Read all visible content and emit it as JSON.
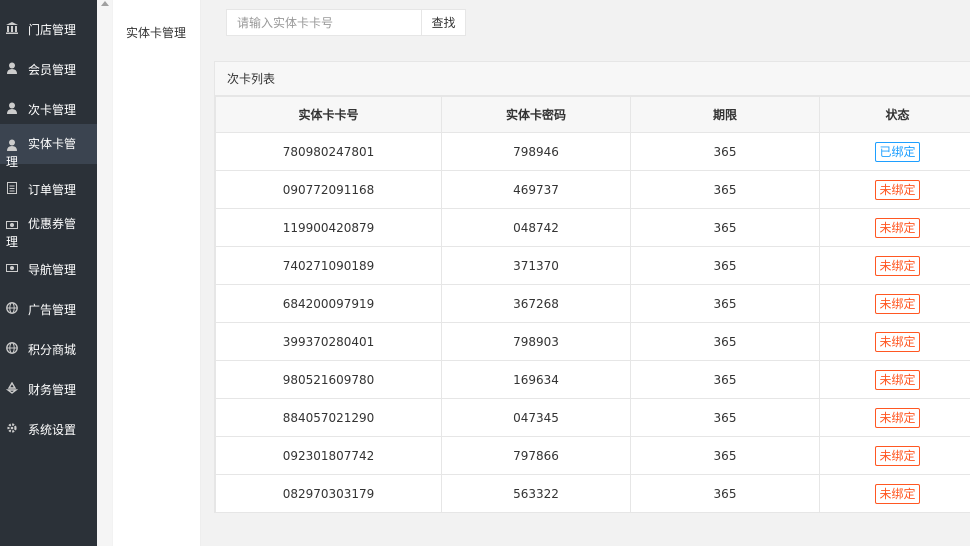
{
  "sidebar": {
    "items": [
      {
        "label": "门店管理",
        "icon": "bank-icon"
      },
      {
        "label": "会员管理",
        "icon": "user-icon"
      },
      {
        "label": "次卡管理",
        "icon": "user-icon"
      },
      {
        "label": "实体卡管理",
        "icon": "user-icon",
        "active": true
      },
      {
        "label": "订单管理",
        "icon": "document-icon"
      },
      {
        "label": "优惠券管理",
        "icon": "money-icon"
      },
      {
        "label": "导航管理",
        "icon": "money-icon"
      },
      {
        "label": "广告管理",
        "icon": "globe-icon"
      },
      {
        "label": "积分商城",
        "icon": "globe-icon"
      },
      {
        "label": "财务管理",
        "icon": "recycle-icon"
      },
      {
        "label": "系统设置",
        "icon": "gear-icon"
      }
    ]
  },
  "submenu": {
    "item": "实体卡管理"
  },
  "search": {
    "placeholder": "请输入实体卡卡号",
    "button": "查找"
  },
  "panel": {
    "title": "次卡列表"
  },
  "table": {
    "columns": [
      "实体卡卡号",
      "实体卡密码",
      "期限",
      "状态"
    ],
    "rows": [
      {
        "card": "780980247801",
        "password": "798946",
        "term": "365",
        "status": "已绑定",
        "bound": true
      },
      {
        "card": "090772091168",
        "password": "469737",
        "term": "365",
        "status": "未绑定",
        "bound": false
      },
      {
        "card": "119900420879",
        "password": "048742",
        "term": "365",
        "status": "未绑定",
        "bound": false
      },
      {
        "card": "740271090189",
        "password": "371370",
        "term": "365",
        "status": "未绑定",
        "bound": false
      },
      {
        "card": "684200097919",
        "password": "367268",
        "term": "365",
        "status": "未绑定",
        "bound": false
      },
      {
        "card": "399370280401",
        "password": "798903",
        "term": "365",
        "status": "未绑定",
        "bound": false
      },
      {
        "card": "980521609780",
        "password": "169634",
        "term": "365",
        "status": "未绑定",
        "bound": false
      },
      {
        "card": "884057021290",
        "password": "047345",
        "term": "365",
        "status": "未绑定",
        "bound": false
      },
      {
        "card": "092301807742",
        "password": "797866",
        "term": "365",
        "status": "未绑定",
        "bound": false
      },
      {
        "card": "082970303179",
        "password": "563322",
        "term": "365",
        "status": "未绑定",
        "bound": false
      }
    ]
  },
  "colors": {
    "sidebar_bg": "#2b3138",
    "bound": "#1e9fff",
    "unbound": "#ff5722"
  }
}
